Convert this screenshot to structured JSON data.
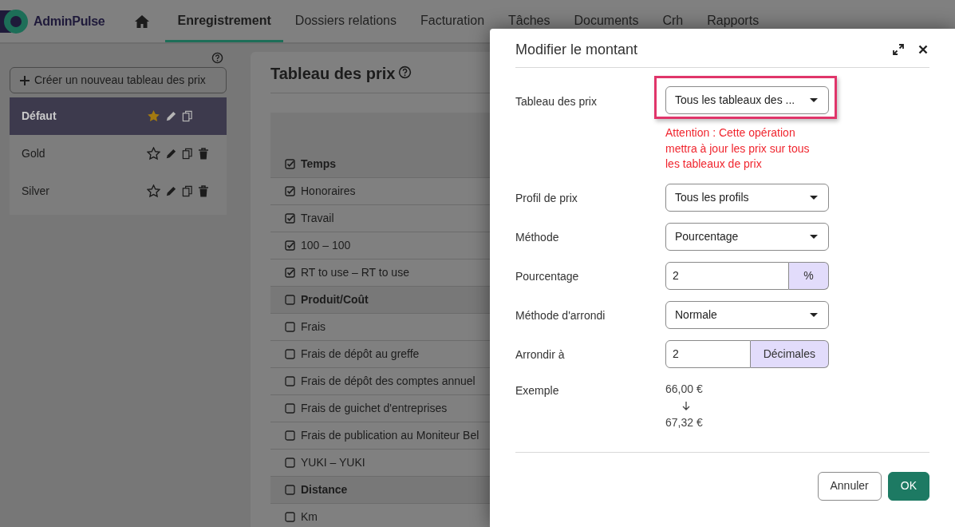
{
  "nav": {
    "brand": "AdminPulse",
    "items": [
      {
        "label": "Enregistrement",
        "selected": true
      },
      {
        "label": "Dossiers relations",
        "selected": false
      },
      {
        "label": "Facturation",
        "selected": false
      },
      {
        "label": "Tâches",
        "selected": false
      },
      {
        "label": "Documents",
        "selected": false
      },
      {
        "label": "Crh",
        "selected": false
      },
      {
        "label": "Rapports",
        "selected": false
      }
    ]
  },
  "sidebar": {
    "create_button": "Créer un nouveau tableau des prix",
    "price_tables": [
      {
        "name": "Défaut",
        "selected": true,
        "favorite": true,
        "deletable": false
      },
      {
        "name": "Gold",
        "selected": false,
        "favorite": false,
        "deletable": true
      },
      {
        "name": "Silver",
        "selected": false,
        "favorite": false,
        "deletable": true
      }
    ]
  },
  "main": {
    "title": "Tableau des prix",
    "rows": [
      {
        "kind": "group",
        "label": "Temps",
        "checked": true
      },
      {
        "kind": "item",
        "label": "Honoraires",
        "checked": true
      },
      {
        "kind": "item",
        "label": "Travail",
        "checked": true
      },
      {
        "kind": "item",
        "label": "100 – 100",
        "checked": true
      },
      {
        "kind": "item",
        "label": "RT to use – RT to use",
        "checked": true
      },
      {
        "kind": "group",
        "label": "Produit/Coût",
        "checked": false
      },
      {
        "kind": "item",
        "label": "Frais",
        "checked": false
      },
      {
        "kind": "item",
        "label": "Frais de dépôt au greffe",
        "checked": false
      },
      {
        "kind": "item",
        "label": "Frais de dépôt des comptes annuel",
        "checked": false
      },
      {
        "kind": "item",
        "label": "Frais de guichet d'entreprises",
        "checked": false
      },
      {
        "kind": "item",
        "label": "Frais de publication au Moniteur Bel",
        "checked": false
      },
      {
        "kind": "item",
        "label": "YUKI – YUKI",
        "checked": false
      },
      {
        "kind": "group",
        "label": "Distance",
        "checked": false
      },
      {
        "kind": "item",
        "label": "Km",
        "checked": false
      }
    ]
  },
  "modal": {
    "title": "Modifier le montant",
    "fields": [
      {
        "kind": "select",
        "label": "Tableau des prix",
        "value": "Tous les tableaux des ...",
        "highlighted": true,
        "warning": "Attention : Cette opération mettra à jour les prix sur tous les tableaux de prix"
      },
      {
        "kind": "select",
        "label": "Profil de prix",
        "value": "Tous les profils",
        "highlighted": false
      },
      {
        "kind": "select",
        "label": "Méthode",
        "value": "Pourcentage",
        "highlighted": false
      },
      {
        "kind": "addon",
        "label": "Pourcentage",
        "value": "2",
        "addon": "%",
        "highlighted": false
      },
      {
        "kind": "select",
        "label": "Méthode d'arrondi",
        "value": "Normale",
        "highlighted": false
      },
      {
        "kind": "addon",
        "label": "Arrondir à",
        "value": "2",
        "addon": "Décimales",
        "highlighted": false
      }
    ],
    "example": {
      "label": "Exemple",
      "from": "66,00 €",
      "to": "67,32 €"
    },
    "buttons": [
      {
        "label": "Annuler",
        "kind": "secondary"
      },
      {
        "label": "OK",
        "kind": "primary"
      }
    ]
  }
}
